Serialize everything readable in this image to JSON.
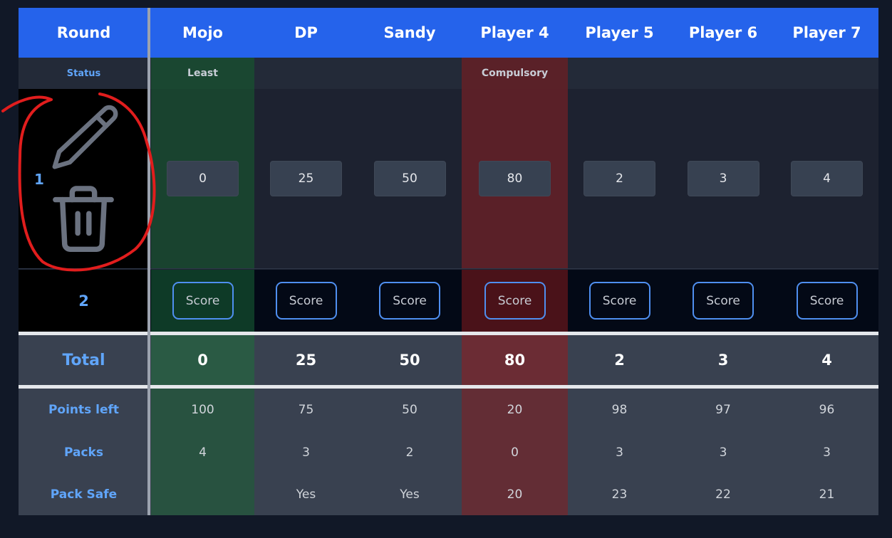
{
  "header": {
    "round": "Round",
    "players": [
      "Mojo",
      "DP",
      "Sandy",
      "Player 4",
      "Player 5",
      "Player 6",
      "Player 7"
    ]
  },
  "status_row": {
    "label": "Status",
    "values": [
      "Least",
      "",
      "",
      "Compulsory",
      "",
      "",
      ""
    ]
  },
  "rounds": [
    {
      "number": "1",
      "scores": [
        "0",
        "25",
        "50",
        "80",
        "2",
        "3",
        "4"
      ]
    },
    {
      "number": "2",
      "button_label": "Score"
    }
  ],
  "total": {
    "label": "Total",
    "values": [
      "0",
      "25",
      "50",
      "80",
      "2",
      "3",
      "4"
    ]
  },
  "points_left": {
    "label": "Points left",
    "values": [
      "100",
      "75",
      "50",
      "20",
      "98",
      "97",
      "96"
    ]
  },
  "packs": {
    "label": "Packs",
    "values": [
      "4",
      "3",
      "2",
      "0",
      "3",
      "3",
      "3"
    ]
  },
  "pack_safe": {
    "label": "Pack Safe",
    "values": [
      "",
      "Yes",
      "Yes",
      "20",
      "23",
      "22",
      "21"
    ]
  },
  "icons": {
    "edit": "pencil-icon",
    "delete": "trash-icon"
  },
  "colors": {
    "header": "#2563eb",
    "accent_text": "#60a5fa",
    "least_highlight": "#1a4731",
    "compulsory_highlight": "#5a2128",
    "annotation": "#e11d1d"
  }
}
